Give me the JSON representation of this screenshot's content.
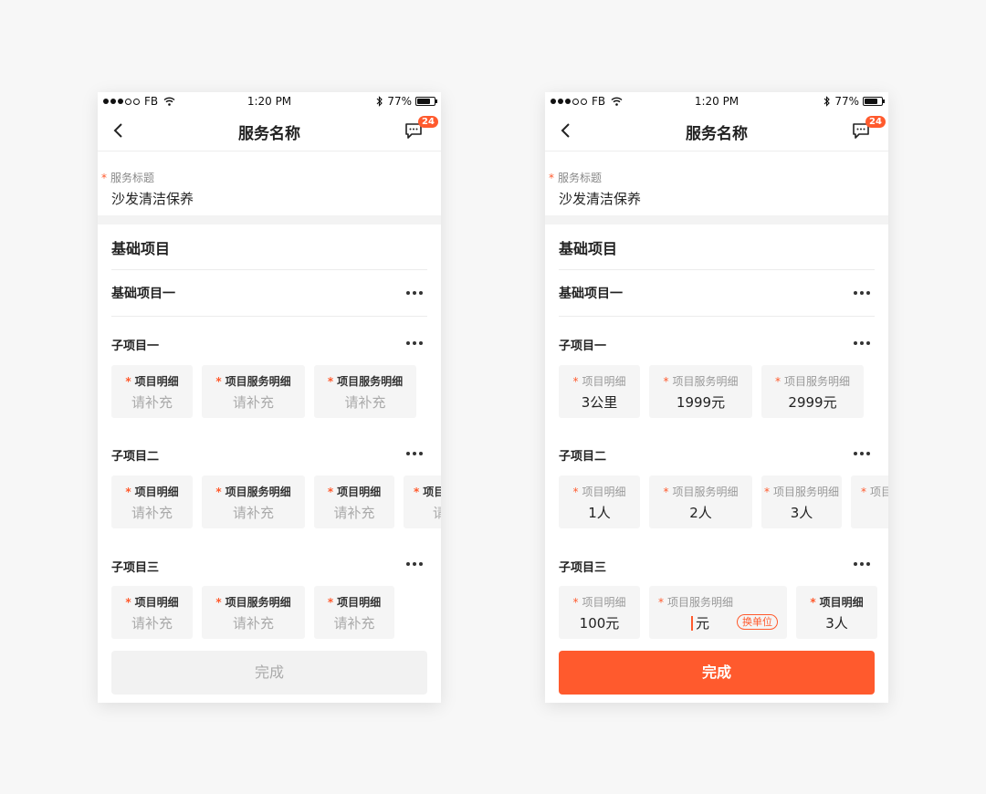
{
  "status_bar": {
    "carrier": "FB",
    "time": "1:20 PM",
    "battery": "77%",
    "battery_level": 0.77
  },
  "nav": {
    "title": "服务名称",
    "badge": "24"
  },
  "service": {
    "label": "服务标题",
    "value": "沙发清洁保养"
  },
  "section_title": "基础项目",
  "group_title": "基础项目一",
  "subgroups": [
    "子项目一",
    "子项目二",
    "子项目三"
  ],
  "required_mark": "*",
  "left_screen": {
    "rows": [
      [
        {
          "label": "项目明细",
          "value": "请补充"
        },
        {
          "label": "项目服务明细",
          "value": "请补充"
        },
        {
          "label": "项目服务明细",
          "value": "请补充"
        }
      ],
      [
        {
          "label": "项目明细",
          "value": "请补充"
        },
        {
          "label": "项目服务明细",
          "value": "请补充"
        },
        {
          "label": "项目明细",
          "value": "请补充"
        },
        {
          "label": "项目",
          "value": "请"
        }
      ],
      [
        {
          "label": "项目明细",
          "value": "请补充"
        },
        {
          "label": "项目服务明细",
          "value": "请补充"
        },
        {
          "label": "项目明细",
          "value": "请补充"
        }
      ]
    ],
    "done_label": "完成"
  },
  "right_screen": {
    "rows": [
      [
        {
          "label": "项目明细",
          "value": "3公里"
        },
        {
          "label": "项目服务明细",
          "value": "1999元"
        },
        {
          "label": "项目服务明细",
          "value": "2999元"
        }
      ],
      [
        {
          "label": "项目明细",
          "value": "1人"
        },
        {
          "label": "项目服务明细",
          "value": "2人"
        },
        {
          "label": "项目服务明细",
          "value": "3人"
        },
        {
          "label": "项目"
        }
      ],
      [
        {
          "label": "项目明细",
          "value": "100元"
        },
        {
          "label": "项目服务明细",
          "value": "元",
          "unit_button": "换单位"
        },
        {
          "label": "项目明细",
          "value": "3人"
        }
      ]
    ],
    "done_label": "完成"
  },
  "colors": {
    "accent": "#ff5a2d",
    "background": "#f7f7f7",
    "chip": "#f5f5f5"
  }
}
